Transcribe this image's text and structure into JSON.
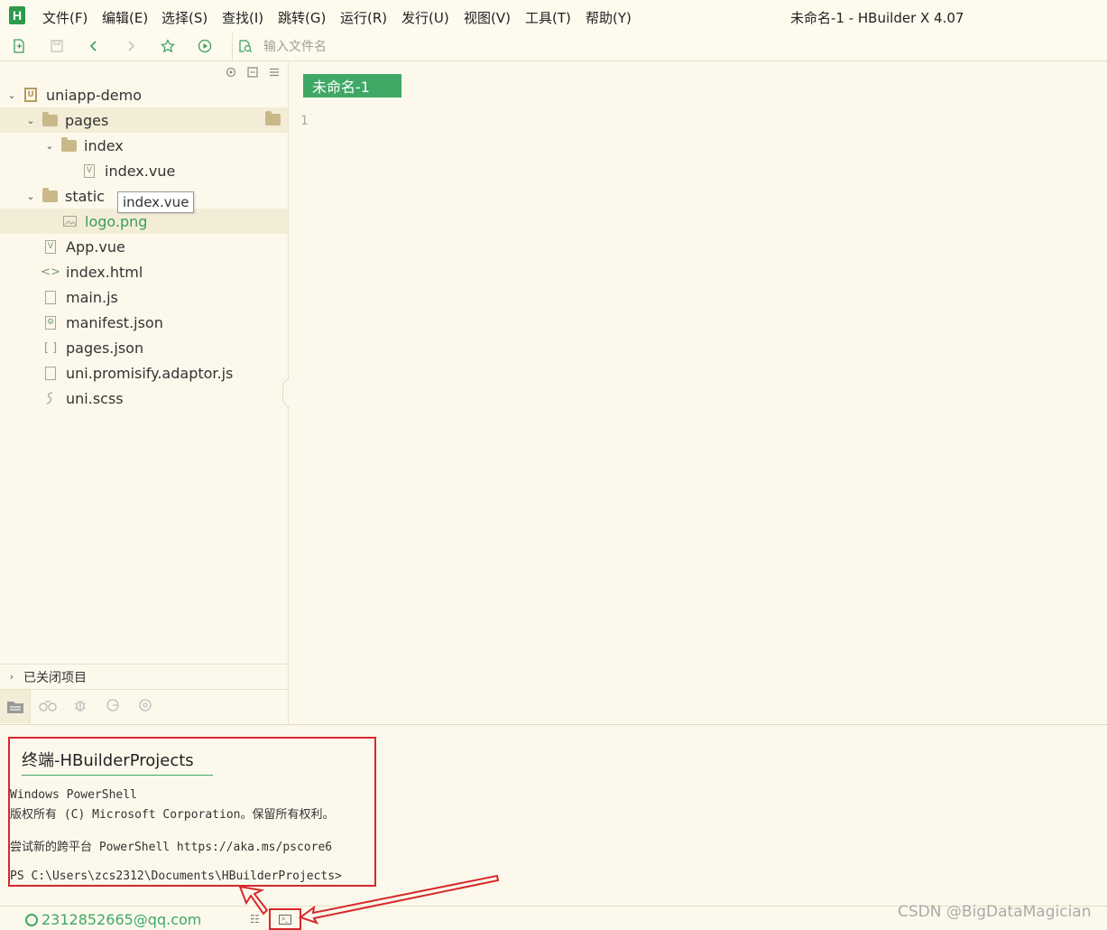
{
  "app": {
    "logo_text": "H",
    "title": "未命名-1 - HBuilder X 4.07"
  },
  "menu": [
    "文件(F)",
    "编辑(E)",
    "选择(S)",
    "查找(I)",
    "跳转(G)",
    "运行(R)",
    "发行(U)",
    "视图(V)",
    "工具(T)",
    "帮助(Y)"
  ],
  "toolbar": {
    "file_search_placeholder": "输入文件名"
  },
  "tree": [
    {
      "label": "uniapp-demo",
      "icon": "project-icon",
      "depth": 0,
      "expanded": true
    },
    {
      "label": "pages",
      "icon": "folder-icon",
      "depth": 1,
      "expanded": true,
      "highlighted": true
    },
    {
      "label": "index",
      "icon": "folder-icon",
      "depth": 2,
      "expanded": true
    },
    {
      "label": "index.vue",
      "icon": "vue-file-icon",
      "depth": 3
    },
    {
      "label": "static",
      "icon": "folder-icon",
      "depth": 1,
      "expanded": true
    },
    {
      "label": "logo.png",
      "icon": "image-file-icon",
      "depth": 2,
      "active": true
    },
    {
      "label": "App.vue",
      "icon": "vue-file-icon",
      "depth": 1
    },
    {
      "label": "index.html",
      "icon": "html-file-icon",
      "depth": 1
    },
    {
      "label": "main.js",
      "icon": "js-file-icon",
      "depth": 1
    },
    {
      "label": "manifest.json",
      "icon": "manifest-file-icon",
      "depth": 1
    },
    {
      "label": "pages.json",
      "icon": "json-file-icon",
      "depth": 1
    },
    {
      "label": "uni.promisify.adaptor.js",
      "icon": "js-file-icon",
      "depth": 1
    },
    {
      "label": "uni.scss",
      "icon": "scss-file-icon",
      "depth": 1
    }
  ],
  "tooltip": "index.vue",
  "closed_projects": "已关闭项目",
  "editor": {
    "tab": "未命名-1",
    "line_number": "1"
  },
  "terminal": {
    "tab": "终端-HBuilderProjects",
    "lines": [
      "Windows PowerShell",
      "版权所有 (C) Microsoft Corporation。保留所有权利。",
      "",
      "尝试新的跨平台 PowerShell https://aka.ms/pscore6",
      "",
      "PS C:\\Users\\zcs2312\\Documents\\HBuilderProjects>"
    ]
  },
  "status": {
    "user": "2312852665@qq.com"
  },
  "watermark": "CSDN @BigDataMagician",
  "colors": {
    "accent": "#3fa865",
    "annotation": "#d6282c",
    "background": "#fcf9ec"
  }
}
